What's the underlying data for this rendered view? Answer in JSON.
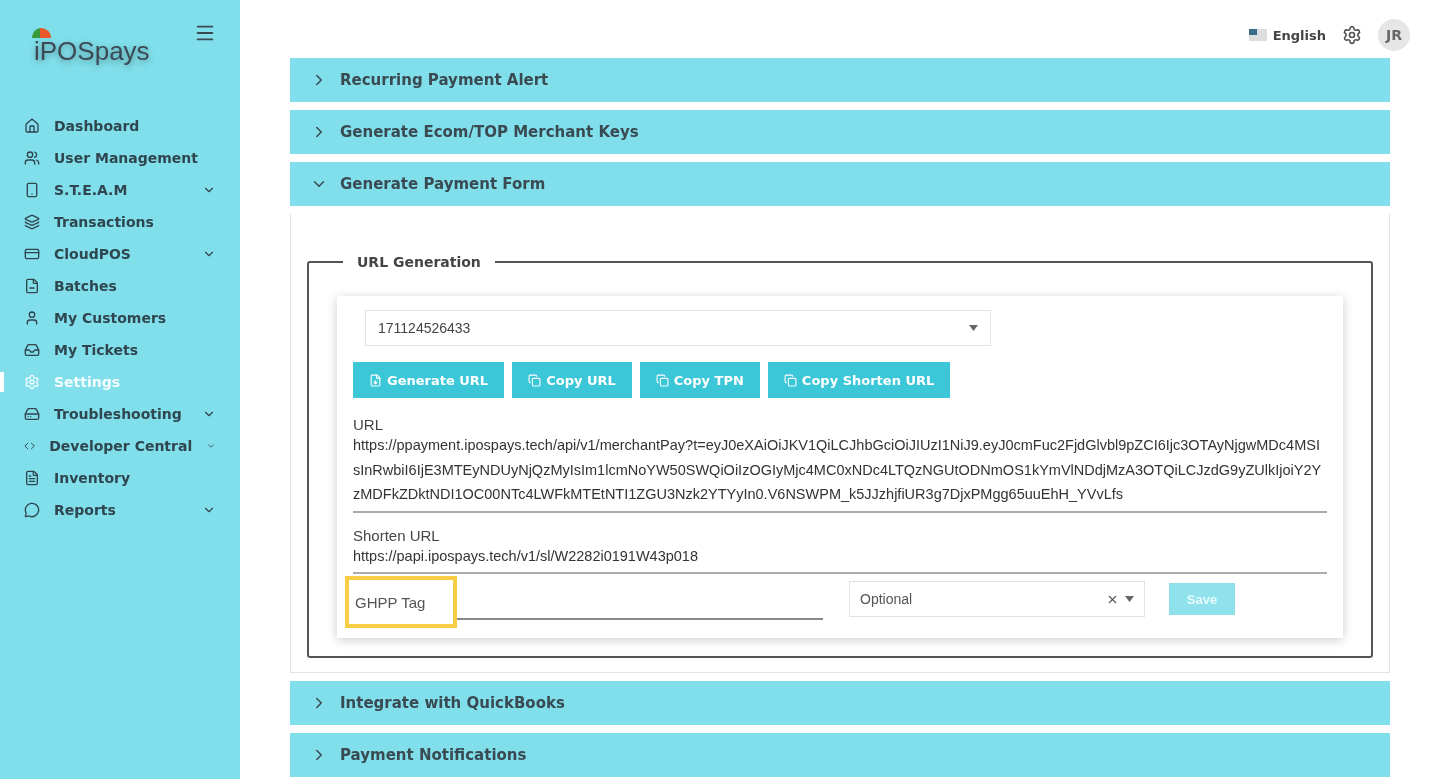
{
  "sidebar": {
    "logo": "iPOSpays",
    "items": [
      {
        "label": "Dashboard",
        "selected": false,
        "has_submenu": false
      },
      {
        "label": "User Management",
        "selected": false,
        "has_submenu": false
      },
      {
        "label": "S.T.E.A.M",
        "selected": false,
        "has_submenu": true
      },
      {
        "label": "Transactions",
        "selected": false,
        "has_submenu": false
      },
      {
        "label": "CloudPOS",
        "selected": false,
        "has_submenu": true
      },
      {
        "label": "Batches",
        "selected": false,
        "has_submenu": false
      },
      {
        "label": "My Customers",
        "selected": false,
        "has_submenu": false
      },
      {
        "label": "My Tickets",
        "selected": false,
        "has_submenu": false
      },
      {
        "label": "Settings",
        "selected": true,
        "has_submenu": false
      },
      {
        "label": "Troubleshooting",
        "selected": false,
        "has_submenu": true
      },
      {
        "label": "Developer Central",
        "selected": false,
        "has_submenu": true
      },
      {
        "label": "Inventory",
        "selected": false,
        "has_submenu": false
      },
      {
        "label": "Reports",
        "selected": false,
        "has_submenu": true
      }
    ]
  },
  "header": {
    "language": "English",
    "avatar": "JR"
  },
  "sections": [
    {
      "title": "Recurring Payment Alert",
      "expanded": false
    },
    {
      "title": "Generate Ecom/TOP Merchant Keys",
      "expanded": false
    },
    {
      "title": "Generate Payment Form",
      "expanded": true
    },
    {
      "title": "Integrate with QuickBooks",
      "expanded": false
    },
    {
      "title": "Payment Notifications",
      "expanded": false
    }
  ],
  "url_generation": {
    "legend": "URL Generation",
    "tpn": "171124526433",
    "buttons": [
      "Generate URL",
      "Copy URL",
      "Copy TPN",
      "Copy Shorten URL"
    ],
    "url_label": "URL",
    "url": "https://ppayment.ipospays.tech/api/v1/merchantPay?t=eyJ0eXAiOiJKV1QiLCJhbGciOiJIUzI1NiJ9.eyJ0cmFuc2FjdGlvbl9pZCI6Ijc3OTAyNjgwMDc4MSIsInRwbiI6IjE3MTEyNDUyNjQzMyIsIm1lcmNoYW50SWQiOiIzOGIyMjc4MC0xNDc4LTQzNGUtODNmOS1kYmVlNDdjMzA3OTQiLCJzdG9yZUlkIjoiY2YzMDFkZDktNDI1OC00NTc4LWFkMTEtNTI1ZGU3Nzk2YTYyIn0.V6NSWPM_k5JJzhjfiUR3g7DjxPMgg65uuEhH_YVvLfs",
    "shorten_label": "Shorten URL",
    "shorten_url": "https://papi.ipospays.tech/v1/sl/W2282i0191W43p018",
    "tag": {
      "placeholder": "GHPP Tag",
      "highlighted": true
    },
    "select": {
      "placeholder": "Optional"
    },
    "save": {
      "label": "Save",
      "disabled": true
    }
  }
}
